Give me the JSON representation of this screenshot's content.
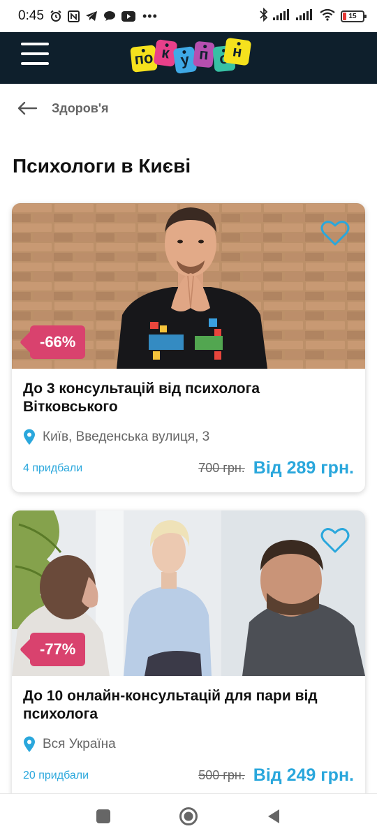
{
  "status_bar": {
    "time": "0:45",
    "dots": "•••",
    "battery": "15"
  },
  "header": {
    "logo_letters": [
      "по",
      "к",
      "у",
      "п",
      "о",
      "н"
    ],
    "logo_colors": [
      "#f5e11d",
      "#e8408a",
      "#3fa9e6",
      "#b64fb0",
      "#37c0a4",
      "#f5e11d"
    ]
  },
  "breadcrumb": {
    "label": "Здоров'я"
  },
  "page": {
    "title": "Психологи в Києві"
  },
  "colors": {
    "header_bg": "#0e1f2c",
    "accent_blue": "#2aa7dc",
    "discount_pink": "#d9426e"
  },
  "deals": [
    {
      "discount": "-66%",
      "title": "До 3 консультацій від психолога Вітковського",
      "location": "Київ, Введенська вулиця, 3",
      "bought": "4 придбали",
      "old_price": "700 грн.",
      "new_price": "Від 289 грн."
    },
    {
      "discount": "-77%",
      "title": "До 10 онлайн-консультацій для пари від психолога",
      "location": "Вся Україна",
      "bought": "20 придбали",
      "old_price": "500 грн.",
      "new_price": "Від 249 грн."
    }
  ]
}
